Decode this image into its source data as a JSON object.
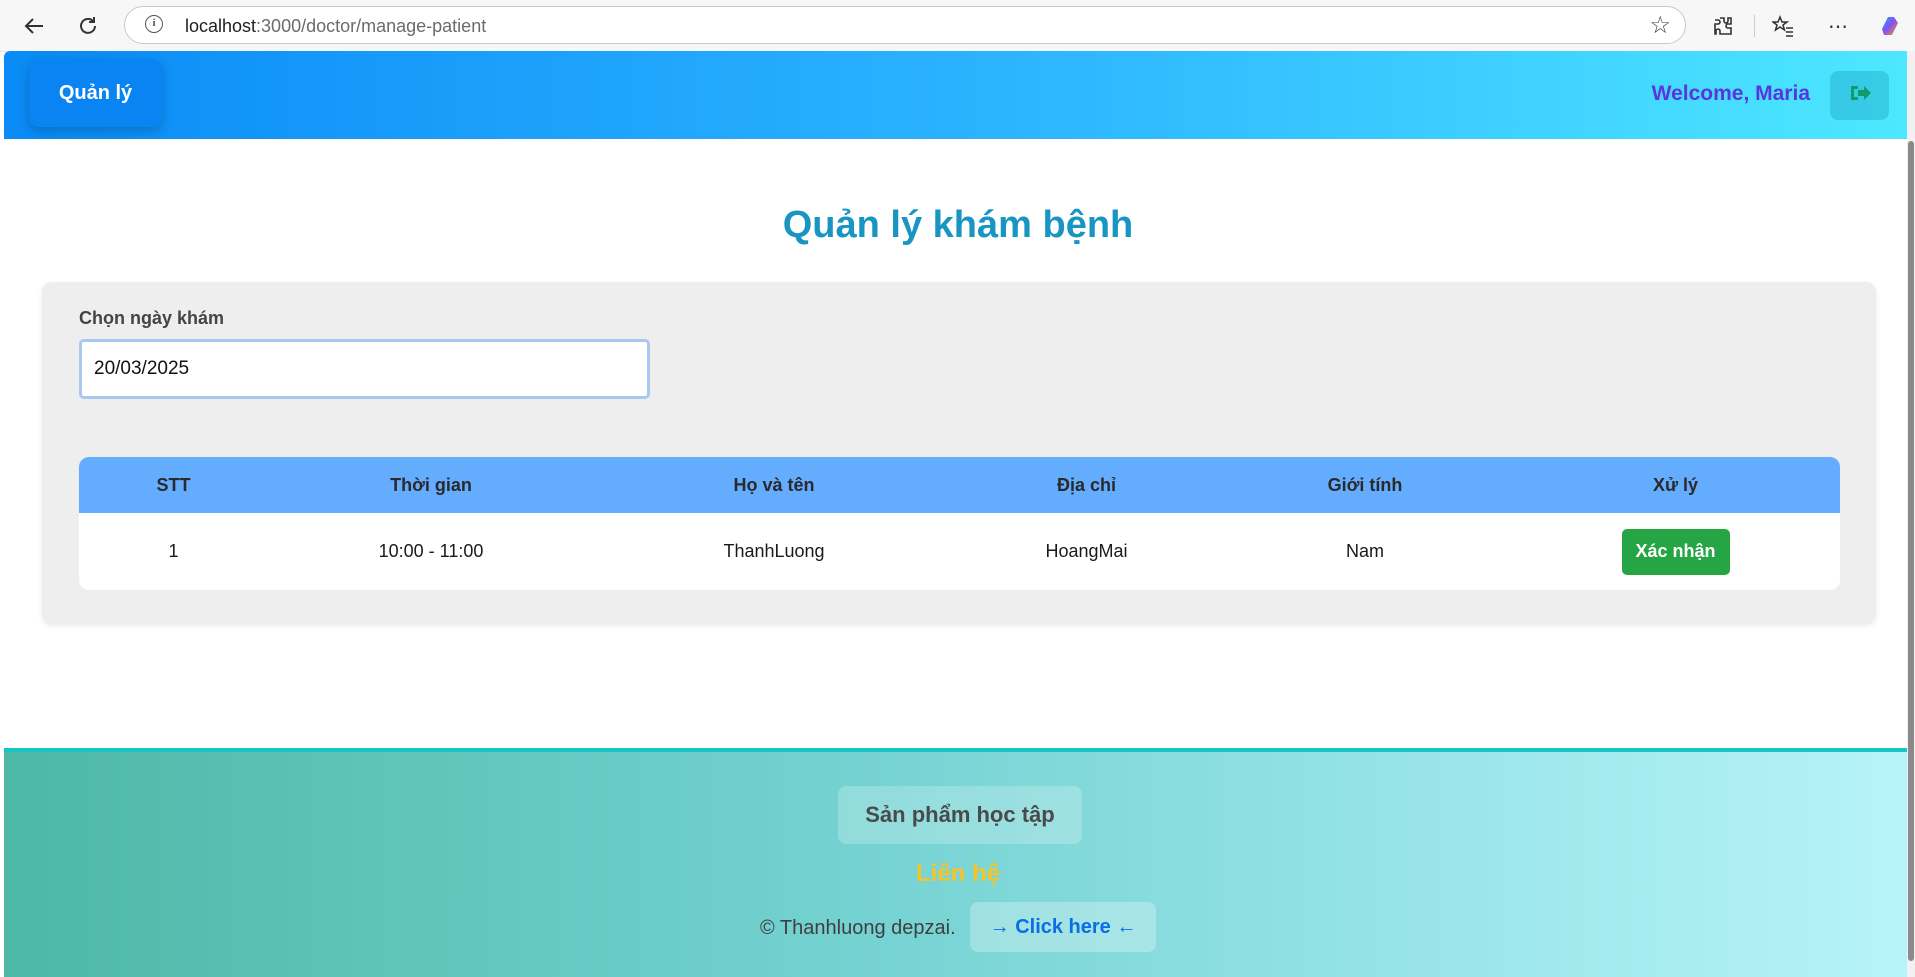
{
  "browser": {
    "url_host": "localhost",
    "url_path": ":3000/doctor/manage-patient"
  },
  "header": {
    "brand": "Quản lý",
    "welcome": "Welcome, Maria"
  },
  "main": {
    "title": "Quản lý khám bệnh",
    "date_label": "Chọn ngày khám",
    "date_value": "20/03/2025",
    "table": {
      "columns": [
        "STT",
        "Thời gian",
        "Họ và tên",
        "Địa chỉ",
        "Giới tính",
        "Xử lý"
      ],
      "rows": [
        {
          "stt": "1",
          "time": "10:00 - 11:00",
          "name": "ThanhLuong",
          "address": "HoangMai",
          "gender": "Nam",
          "action": "Xác nhận"
        }
      ]
    }
  },
  "footer": {
    "product": "Sản phẩm học tập",
    "contact": "Liên hệ",
    "copyright": "© Thanhluong depzai.",
    "click_here": "→ Click here ←"
  },
  "colors": {
    "header_gradient_start": "#0a8bf7",
    "header_gradient_end": "#4de8ff",
    "title": "#1995c2",
    "table_header": "#64acfd",
    "confirm": "#26a545",
    "contact": "#f7c325"
  }
}
